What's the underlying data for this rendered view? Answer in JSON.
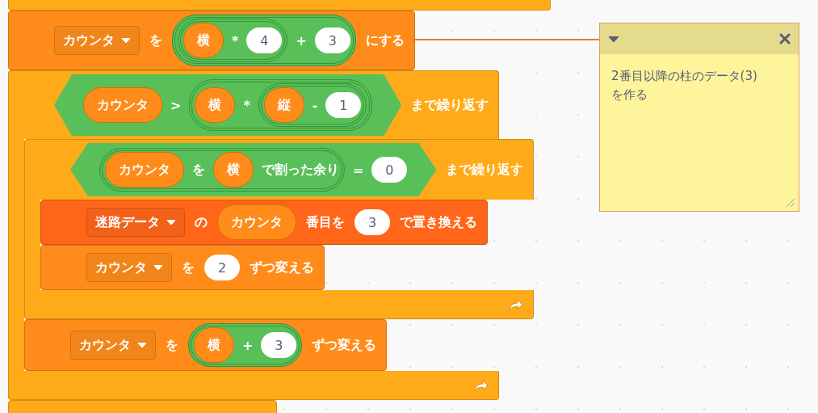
{
  "script": [
    {
      "kind": "loop_end",
      "color": "#ffab19"
    },
    {
      "kind": "command",
      "color": "#ff8c1a",
      "parts": [
        {
          "kind": "dropdown",
          "text": "カウンタ"
        },
        {
          "kind": "label",
          "text": "を"
        },
        {
          "kind": "operator",
          "parts": [
            {
              "kind": "operator",
              "parts": [
                {
                  "kind": "reporter",
                  "text": "横"
                },
                {
                  "kind": "label",
                  "text": "*"
                },
                {
                  "kind": "number",
                  "text": "4"
                }
              ]
            },
            {
              "kind": "label",
              "text": "+"
            },
            {
              "kind": "number",
              "text": "3"
            }
          ]
        },
        {
          "kind": "label",
          "text": "にする"
        }
      ]
    },
    {
      "kind": "repeat_until",
      "color": "#ffab19",
      "parts": [
        {
          "kind": "boolean",
          "parts": [
            {
              "kind": "reporter",
              "text": "カウンタ"
            },
            {
              "kind": "label",
              "text": ">"
            },
            {
              "kind": "operator",
              "parts": [
                {
                  "kind": "reporter",
                  "text": "横"
                },
                {
                  "kind": "label",
                  "text": "*"
                },
                {
                  "kind": "operator",
                  "parts": [
                    {
                      "kind": "reporter",
                      "text": "縦"
                    },
                    {
                      "kind": "label",
                      "text": "-"
                    },
                    {
                      "kind": "number",
                      "text": "1"
                    }
                  ]
                }
              ]
            }
          ]
        },
        {
          "kind": "label",
          "text": "まで繰り返す"
        }
      ],
      "children": [
        {
          "kind": "repeat_until",
          "color": "#ffab19",
          "parts": [
            {
              "kind": "boolean",
              "parts": [
                {
                  "kind": "operator",
                  "parts": [
                    {
                      "kind": "reporter",
                      "text": "カウンタ"
                    },
                    {
                      "kind": "label",
                      "text": "を"
                    },
                    {
                      "kind": "reporter",
                      "text": "横"
                    },
                    {
                      "kind": "label",
                      "text": "で割った余り"
                    }
                  ]
                },
                {
                  "kind": "label",
                  "text": "="
                },
                {
                  "kind": "number",
                  "text": "0"
                }
              ]
            },
            {
              "kind": "label",
              "text": "まで繰り返す"
            }
          ],
          "children": [
            {
              "kind": "command",
              "color": "#ff661a",
              "parts": [
                {
                  "kind": "dropdown",
                  "text": "迷路データ"
                },
                {
                  "kind": "label",
                  "text": "の"
                },
                {
                  "kind": "reporter",
                  "text": "カウンタ"
                },
                {
                  "kind": "label",
                  "text": "番目を"
                },
                {
                  "kind": "number",
                  "text": "3"
                },
                {
                  "kind": "label",
                  "text": "で置き換える"
                }
              ]
            },
            {
              "kind": "command",
              "color": "#ff8c1a",
              "parts": [
                {
                  "kind": "dropdown",
                  "text": "カウンタ"
                },
                {
                  "kind": "label",
                  "text": "を"
                },
                {
                  "kind": "number",
                  "text": "2"
                },
                {
                  "kind": "label",
                  "text": "ずつ変える"
                }
              ]
            }
          ]
        },
        {
          "kind": "command",
          "color": "#ff8c1a",
          "parts": [
            {
              "kind": "dropdown",
              "text": "カウンタ"
            },
            {
              "kind": "label",
              "text": "を"
            },
            {
              "kind": "operator",
              "parts": [
                {
                  "kind": "reporter",
                  "text": "横"
                },
                {
                  "kind": "label",
                  "text": "+"
                },
                {
                  "kind": "number",
                  "text": "3"
                }
              ]
            },
            {
              "kind": "label",
              "text": "ずつ変える"
            }
          ]
        }
      ]
    },
    {
      "kind": "command_stub",
      "color": "#ffab19"
    }
  ],
  "comment": {
    "text": "2番目以降の柱のデータ(3)を作る"
  }
}
